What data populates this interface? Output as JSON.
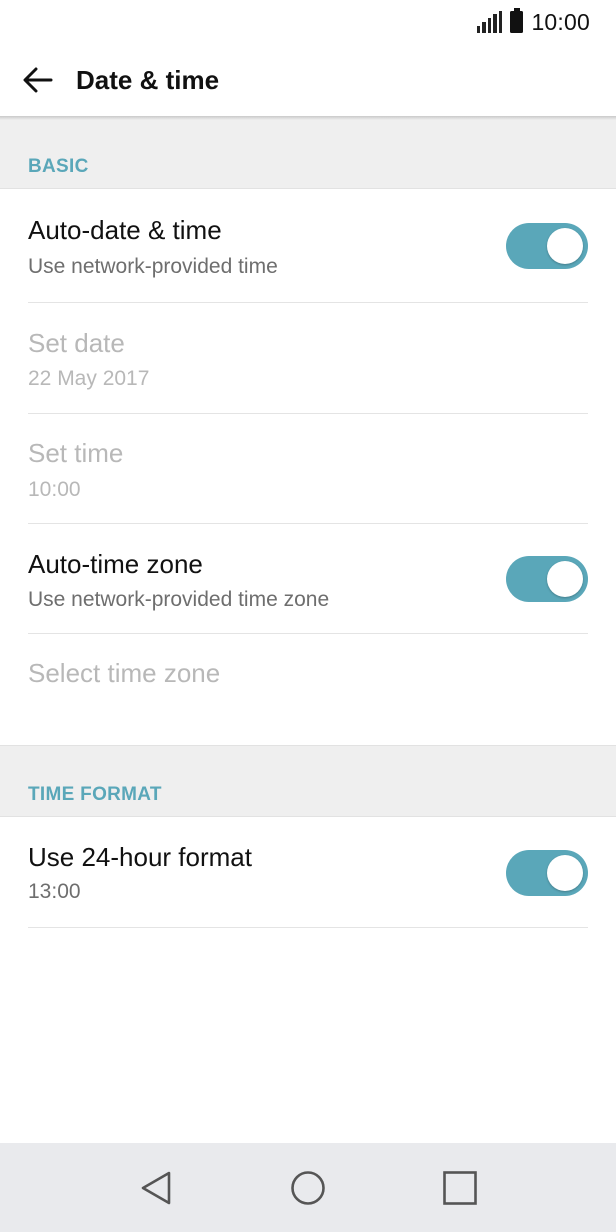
{
  "status_bar": {
    "time": "10:00",
    "icons": [
      "signal-icon",
      "battery-icon"
    ]
  },
  "toolbar": {
    "back_icon": "arrow-left-icon",
    "title": "Date & time"
  },
  "sections": {
    "basic": {
      "header": "BASIC",
      "auto_date_time": {
        "title": "Auto-date & time",
        "subtitle": "Use network-provided time",
        "toggle_on": true
      },
      "set_date": {
        "title": "Set date",
        "subtitle": "22 May 2017",
        "enabled": false
      },
      "set_time": {
        "title": "Set time",
        "subtitle": "10:00",
        "enabled": false
      },
      "auto_time_zone": {
        "title": "Auto-time zone",
        "subtitle": "Use network-provided time zone",
        "toggle_on": true
      },
      "select_time_zone": {
        "title": "Select time zone",
        "enabled": false
      }
    },
    "time_format": {
      "header": "TIME FORMAT",
      "use_24_hour": {
        "title": "Use 24-hour format",
        "subtitle": "13:00",
        "toggle_on": true
      }
    }
  },
  "nav_bar": {
    "icons": [
      "back-triangle-icon",
      "home-circle-icon",
      "recents-square-icon"
    ]
  },
  "colors": {
    "accent": "#5aa7b9",
    "section_bg": "#efefef",
    "nav_bg": "#e9eaed"
  }
}
